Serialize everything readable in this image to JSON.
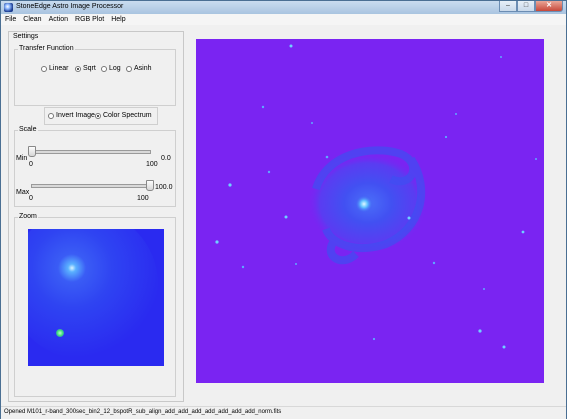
{
  "window": {
    "title": "StoneEdge Astro Image Processor",
    "minimize": "–",
    "maximize": "□",
    "close": "✕"
  },
  "menu": [
    "File",
    "Clean",
    "Action",
    "RGB Plot",
    "Help"
  ],
  "settings": {
    "title": "Settings",
    "transfer": {
      "title": "Transfer Function",
      "options": [
        "Linear",
        "Sqrt",
        "Log",
        "Asinh"
      ],
      "selected": "Sqrt"
    },
    "display": {
      "options": [
        "Invert Image",
        "Color Spectrum"
      ],
      "selected": "Color Spectrum"
    },
    "scale": {
      "title": "Scale",
      "min": {
        "label": "Min",
        "value": "0.0",
        "tick_min": "0",
        "tick_max": "100",
        "level": 0
      },
      "max": {
        "label": "Max",
        "value": "100.0",
        "tick_min": "0",
        "tick_max": "100",
        "level": 100
      }
    },
    "zoom": {
      "title": "Zoom"
    }
  },
  "colors": {
    "image_bg": "#7a24f2",
    "zoom_bg": "#2a2af0",
    "galaxy": "#3a3af0"
  },
  "status": "Opened M101_r-band_300sec_bin2_12_bspotR_sub_align_add_add_add_add_add_add_add_norm.fits"
}
